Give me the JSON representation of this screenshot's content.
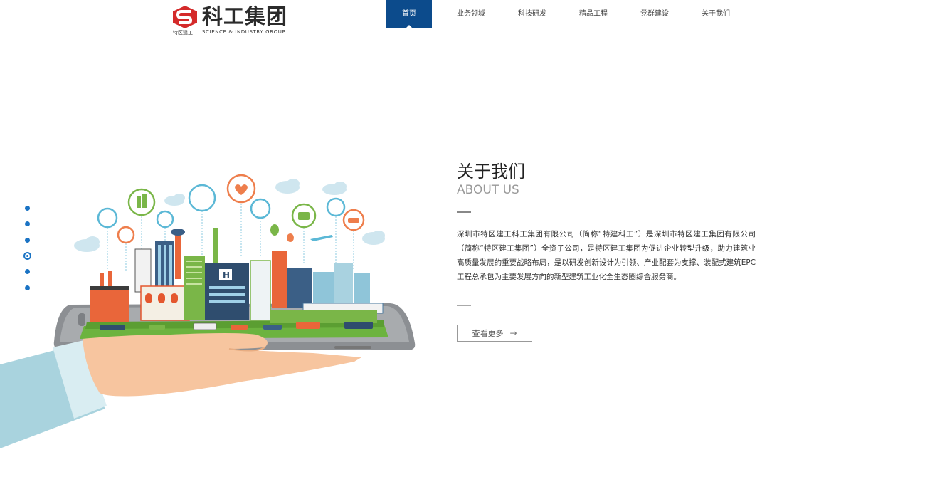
{
  "header": {
    "logo": {
      "name_cn": "科工集团",
      "sub_cn": "特区建工",
      "sub_en": "SCIENCE & INDUSTRY GROUP"
    },
    "nav": [
      {
        "label": "首页",
        "active": true
      },
      {
        "label": "业务领域",
        "active": false
      },
      {
        "label": "科技研发",
        "active": false
      },
      {
        "label": "精品工程",
        "active": false
      },
      {
        "label": "党群建设",
        "active": false
      },
      {
        "label": "关于我们",
        "active": false
      }
    ]
  },
  "pager": {
    "count": 6,
    "active_index": 3
  },
  "about": {
    "title_cn": "关于我们",
    "title_en": "ABOUT US",
    "description": "深圳市特区建工科工集团有限公司（简称“特建科工”）是深圳市特区建工集团有限公司（简称“特区建工集团”）全资子公司，是特区建工集团为促进企业转型升级，助力建筑业高质量发展的重要战略布局，是以研发创新设计为引领、产业配套为支撑、装配式建筑EPC工程总承包为主要发展方向的新型建筑工业化全生态圈综合服务商。",
    "more_label": "查看更多",
    "more_icon": "arrow-right-icon"
  },
  "colors": {
    "nav_active": "#0c4b8c",
    "logo_red": "#d42a2a",
    "pager": "#1a73c4"
  }
}
